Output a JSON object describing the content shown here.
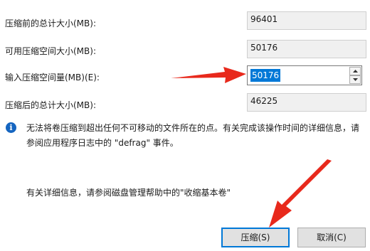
{
  "fields": {
    "total_before_label": "压缩前的总计大小(MB):",
    "total_before_value": "96401",
    "available_label": "可用压缩空间大小(MB):",
    "available_value": "50176",
    "input_label": "输入压缩空间量(MB)(E):",
    "input_value": "50176",
    "total_after_label": "压缩后的总计大小(MB):",
    "total_after_value": "46225"
  },
  "info": {
    "icon": "info-icon",
    "message": "无法将卷压缩到超出任何不可移动的文件所在的点。有关完成该操作时间的详细信息，请参阅应用程序日志中的 \"defrag\" 事件。",
    "more_info": "有关详细信息，请参阅磁盘管理帮助中的\"收缩基本卷\""
  },
  "buttons": {
    "shrink": "压缩(S)",
    "cancel": "取消(C)"
  },
  "colors": {
    "accent": "#0078d7",
    "annotation_arrow": "#e8291c",
    "info_icon": "#1565c0"
  }
}
